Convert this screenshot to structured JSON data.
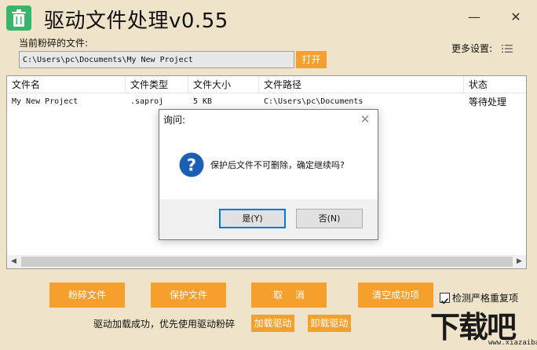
{
  "app": {
    "title": "驱动文件处理v0.55",
    "minimize_glyph": "—",
    "close_glyph": "✕"
  },
  "file_section": {
    "label": "当前粉碎的文件:",
    "path_value": "C:\\Users\\pc\\Documents\\My New Project",
    "open_label": "打开"
  },
  "settings": {
    "more_label": "更多设置:",
    "icon": "list-settings-icon"
  },
  "table": {
    "columns": [
      "文件名",
      "文件类型",
      "文件大小",
      "文件路径",
      "状态"
    ],
    "rows": [
      {
        "name": "My New Project",
        "type": ".saproj",
        "size": "5  KB",
        "path": "C:\\Users\\pc\\Documents",
        "status": "等待处理"
      }
    ],
    "scroll_left": "◀",
    "scroll_right": "▶"
  },
  "actions": {
    "shred": "粉碎文件",
    "protect": "保护文件",
    "cancel": "取　 消",
    "clear_success": "清空成功项",
    "check_label": "检测严格重复项",
    "check_checked": true
  },
  "status": {
    "message": "驱动加载成功，优先使用驱动粉碎",
    "load_driver": "加载驱动",
    "unload_driver": "卸载驱动"
  },
  "dialog": {
    "title": "询问:",
    "close_glyph": "✕",
    "message": "保护后文件不可删除，确定继续吗?",
    "yes": "是(Y)",
    "no": "否(N)",
    "icon": "question-icon"
  },
  "watermark": {
    "main": "下载吧",
    "sub": "www.xiazaiba.com"
  },
  "colors": {
    "background": "#efe3c9",
    "accent": "#f5a02c",
    "app_icon": "#36b56b",
    "dialog_focus": "#0078d7",
    "question_icon": "#1a5fb4"
  }
}
